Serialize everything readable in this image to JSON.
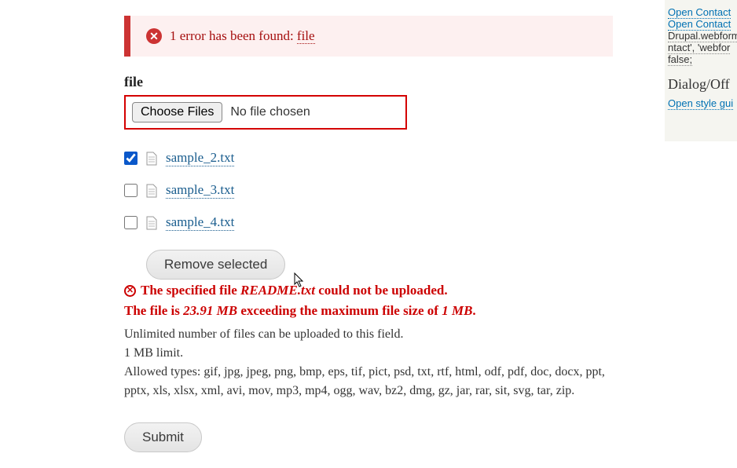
{
  "alert": {
    "prefix": "1 error has been found:",
    "link": "file"
  },
  "field": {
    "label": "file",
    "choose_btn": "Choose Files",
    "no_file": "No file chosen"
  },
  "files": [
    {
      "name": "sample_2.txt",
      "checked": true
    },
    {
      "name": "sample_3.txt",
      "checked": false
    },
    {
      "name": "sample_4.txt",
      "checked": false
    }
  ],
  "remove_btn": "Remove selected",
  "upload_error": {
    "prefix": "The specified file ",
    "filename": "README.txt",
    "suffix": " could not be uploaded."
  },
  "size_error": {
    "p1": "The file is ",
    "size": "23.91 MB",
    "p2": " exceeding the maximum file size of ",
    "limit": "1 MB",
    "p3": "."
  },
  "help": {
    "line1": "Unlimited number of files can be uploaded to this field.",
    "line2": "1 MB limit.",
    "line3": "Allowed types: gif, jpg, jpeg, png, bmp, eps, tif, pict, psd, txt, rtf, html, odf, pdf, doc, docx, ppt, pptx, xls, xlsx, xml, avi, mov, mp3, mp4, ogg, wav, bz2, dmg, gz, jar, rar, sit, svg, tar, zip."
  },
  "submit_btn": "Submit",
  "sidebar": {
    "link1": "Open Contact",
    "link2": "Open Contact",
    "code1": "Drupal.webform",
    "code2": "ntact', 'webfor",
    "code3": "false;",
    "heading": "Dialog/Off",
    "link3": "Open style gui"
  }
}
